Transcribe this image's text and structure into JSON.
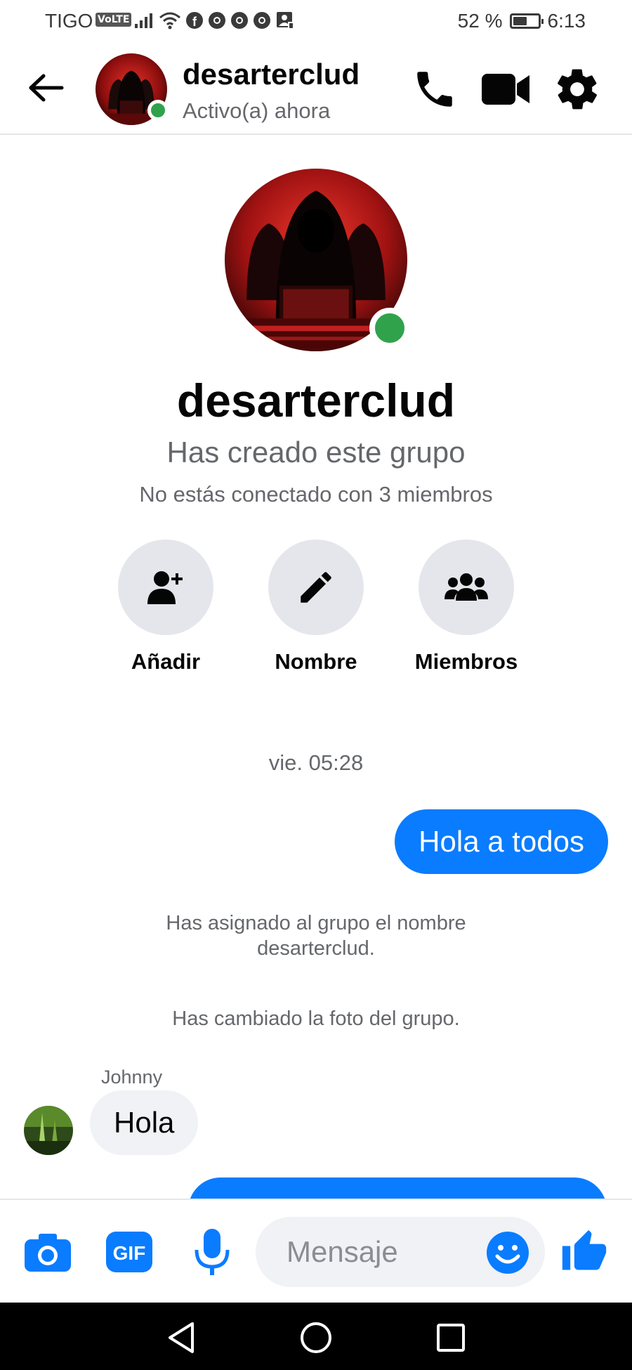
{
  "status_bar": {
    "carrier": "TIGO",
    "network_badge": "VoLTE",
    "battery_percent": "52 %",
    "battery_level": 0.52,
    "time": "6:13",
    "icons": [
      "signal-icon",
      "wifi-icon",
      "facebook-icon",
      "chrome-icon",
      "chrome-icon",
      "chrome-icon",
      "image-notification-icon"
    ]
  },
  "header": {
    "title": "desarterclud",
    "status": "Activo(a) ahora",
    "icons": [
      "back-arrow-icon",
      "phone-icon",
      "video-camera-icon",
      "settings-gear-icon"
    ]
  },
  "profile": {
    "name": "desarterclud",
    "subtitle": "Has creado este grupo",
    "connection_note": "No estás conectado con 3 miembros"
  },
  "actions": [
    {
      "label": "Añadir",
      "icon": "add-person-icon"
    },
    {
      "label": "Nombre",
      "icon": "pencil-icon"
    },
    {
      "label": "Miembros",
      "icon": "group-members-icon"
    }
  ],
  "messages": {
    "timestamp": "vie. 05:28",
    "outgoing_1": "Hola a todos",
    "system_1_line1": "Has asignado al grupo el nombre",
    "system_1_line2": "desarterclud.",
    "system_2": "Has cambiado la foto del grupo.",
    "sender": "Johnny",
    "incoming_1": "Hola"
  },
  "composer": {
    "placeholder": "Mensaje",
    "icons": [
      "camera-icon",
      "gif-icon",
      "microphone-icon",
      "emoji-icon",
      "like-thumb-icon"
    ],
    "gif_label": "GIF"
  },
  "colors": {
    "messenger_blue": "#0a7cff",
    "online_green": "#31a24c",
    "icon_gray_bg": "#e4e6eb",
    "secondary_text": "#65676b"
  }
}
